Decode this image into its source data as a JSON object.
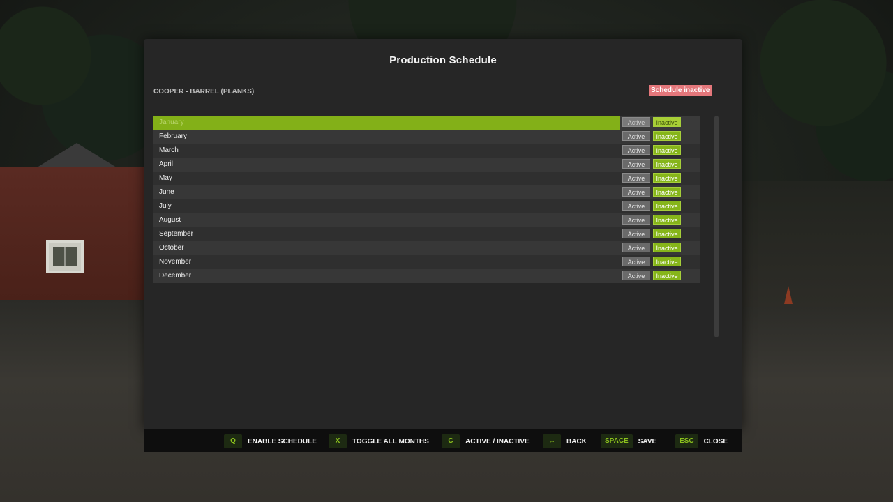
{
  "dialog": {
    "title": "Production Schedule",
    "subtitle": "COOPER - BARREL (PLANKS)",
    "status_badge": "Schedule inactive"
  },
  "months": [
    {
      "name": "January",
      "active_label": "Active",
      "inactive_label": "Inactive",
      "state": "inactive",
      "selected": true
    },
    {
      "name": "February",
      "active_label": "Active",
      "inactive_label": "Inactive",
      "state": "inactive"
    },
    {
      "name": "March",
      "active_label": "Active",
      "inactive_label": "Inactive",
      "state": "inactive"
    },
    {
      "name": "April",
      "active_label": "Active",
      "inactive_label": "Inactive",
      "state": "inactive"
    },
    {
      "name": "May",
      "active_label": "Active",
      "inactive_label": "Inactive",
      "state": "inactive"
    },
    {
      "name": "June",
      "active_label": "Active",
      "inactive_label": "Inactive",
      "state": "inactive"
    },
    {
      "name": "July",
      "active_label": "Active",
      "inactive_label": "Inactive",
      "state": "inactive"
    },
    {
      "name": "August",
      "active_label": "Active",
      "inactive_label": "Inactive",
      "state": "inactive"
    },
    {
      "name": "September",
      "active_label": "Active",
      "inactive_label": "Inactive",
      "state": "inactive"
    },
    {
      "name": "October",
      "active_label": "Active",
      "inactive_label": "Inactive",
      "state": "inactive"
    },
    {
      "name": "November",
      "active_label": "Active",
      "inactive_label": "Inactive",
      "state": "inactive"
    },
    {
      "name": "December",
      "active_label": "Active",
      "inactive_label": "Inactive",
      "state": "inactive"
    }
  ],
  "footer": {
    "hints": [
      {
        "key": "Q",
        "label": "ENABLE SCHEDULE"
      },
      {
        "key": "X",
        "label": "TOGGLE ALL MONTHS"
      },
      {
        "key": "C",
        "label": "ACTIVE / INACTIVE"
      },
      {
        "key": "↔",
        "label": "BACK"
      },
      {
        "key": "SPACE",
        "label": "SAVE"
      },
      {
        "key": "ESC",
        "label": "CLOSE"
      }
    ]
  },
  "colors": {
    "accent": "#83b018",
    "badge_inactive": "#e4777b",
    "panel": "#262626"
  }
}
